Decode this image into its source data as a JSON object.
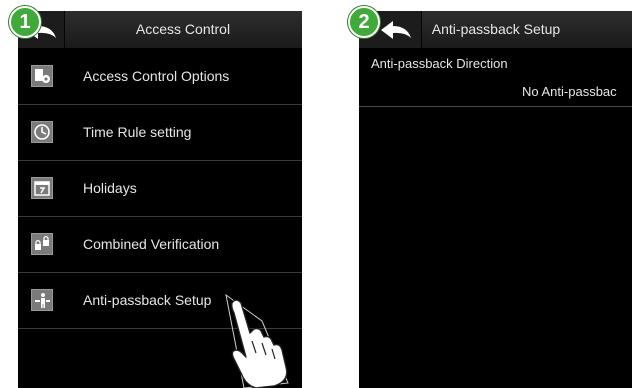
{
  "left_screen": {
    "step_number": "1",
    "title": "Access Control",
    "back_icon": "back-arrow-icon",
    "items": [
      {
        "label": "Access Control Options",
        "icon": "access-options-icon"
      },
      {
        "label": "Time Rule setting",
        "icon": "clock-icon"
      },
      {
        "label": "Holidays",
        "icon": "calendar-icon"
      },
      {
        "label": "Combined Verification",
        "icon": "lock-icon"
      },
      {
        "label": "Anti-passback Setup",
        "icon": "anti-passback-icon"
      }
    ]
  },
  "right_screen": {
    "step_number": "2",
    "title": "Anti-passback Setup",
    "back_icon": "back-arrow-icon",
    "setting": {
      "label": "Anti-passback Direction",
      "value": "No Anti-passbac"
    }
  },
  "colors": {
    "badge_green": "#41a83a",
    "screen_bg": "#000000",
    "text": "#e6e6e6"
  }
}
